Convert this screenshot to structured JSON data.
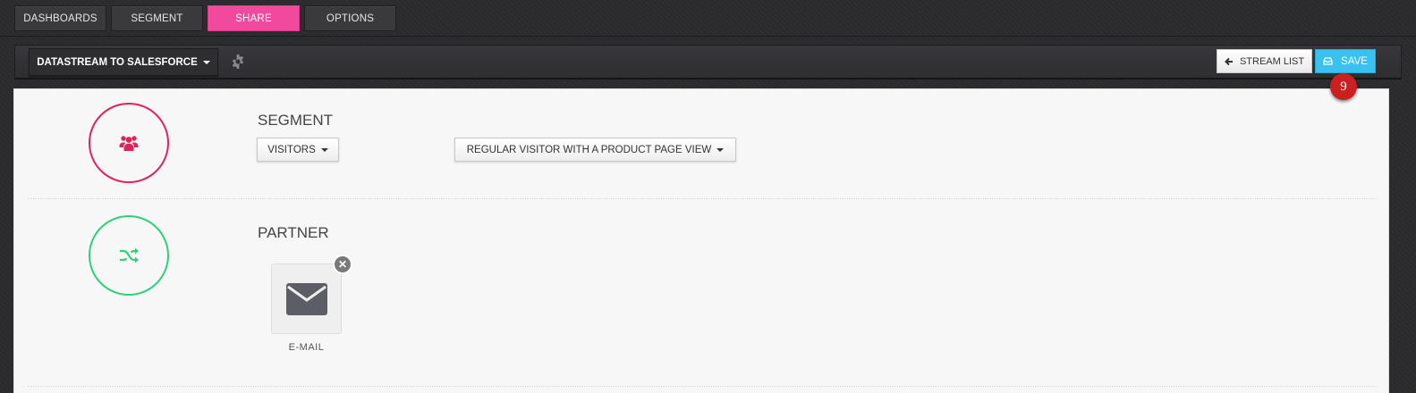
{
  "nav": {
    "tabs": [
      {
        "label": "DASHBOARDS",
        "active": false
      },
      {
        "label": "SEGMENT",
        "active": false
      },
      {
        "label": "SHARE",
        "active": true
      },
      {
        "label": "OPTIONS",
        "active": false
      }
    ]
  },
  "toolbar": {
    "stream_select": "DATASTREAM TO SALESFORCE",
    "settings_icon": "gear-icon",
    "stream_list_label": "STREAM LIST",
    "stream_list_icon": "arrow-left-icon",
    "save_label": "SAVE",
    "save_icon": "inbox-icon",
    "notification_count": "9"
  },
  "segment": {
    "title": "SEGMENT",
    "icon": "users-icon",
    "type_select": "VISITORS",
    "segment_select": "REGULAR VISITOR WITH A PRODUCT PAGE VIEW"
  },
  "partner": {
    "title": "PARTNER",
    "icon": "shuffle-icon",
    "items": [
      {
        "label": "E-MAIL",
        "icon": "envelope-icon"
      }
    ]
  },
  "colors": {
    "accent_pink": "#f0499d",
    "segment_red": "#e0225e",
    "partner_green": "#2ed07c",
    "save_blue": "#3bc1ef",
    "badge_red": "#cc1f1f"
  }
}
